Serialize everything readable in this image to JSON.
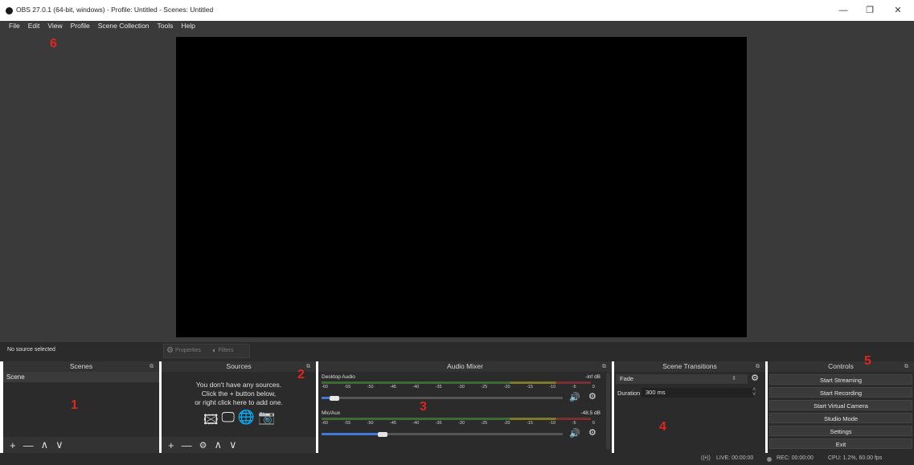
{
  "window": {
    "title": "OBS 27.0.1 (64-bit, windows) - Profile: Untitled - Scenes: Untitled",
    "minimize": "—",
    "maximize": "❐",
    "close": "✕"
  },
  "menu": [
    "File",
    "Edit",
    "View",
    "Profile",
    "Scene Collection",
    "Tools",
    "Help"
  ],
  "source_toolbar": {
    "status": "No source selected",
    "properties": "Properties",
    "filters": "Filters"
  },
  "scenes": {
    "title": "Scenes",
    "items": [
      "Scene"
    ]
  },
  "sources": {
    "title": "Sources",
    "empty_line1": "You don't have any sources.",
    "empty_line2": "Click the + button below,",
    "empty_line3": "or right click here to add one."
  },
  "mixer": {
    "title": "Audio Mixer",
    "channels": [
      {
        "name": "Desktop Audio",
        "db": "-inf dB",
        "volume": 0.04
      },
      {
        "name": "Mic/Aux",
        "db": "-48.5 dB",
        "volume": 0.24
      }
    ],
    "ticks": [
      "-60",
      "-55",
      "-50",
      "-45",
      "-40",
      "-35",
      "-30",
      "-25",
      "-20",
      "-15",
      "-10",
      "-5",
      "0"
    ]
  },
  "transitions": {
    "title": "Scene Transitions",
    "selected": "Fade",
    "duration_label": "Duration",
    "duration_value": "300 ms"
  },
  "controls": {
    "title": "Controls",
    "buttons": [
      "Start Streaming",
      "Start Recording",
      "Start Virtual Camera",
      "Studio Mode",
      "Settings",
      "Exit"
    ]
  },
  "status": {
    "live": "LIVE: 00:00:00",
    "rec": "REC: 00:00:00",
    "cpu": "CPU: 1.2%, 60.00 fps"
  },
  "annotations": [
    "1",
    "2",
    "3",
    "4",
    "5",
    "6"
  ],
  "icons": [
    "obs-logo-icon",
    "gear-icon",
    "filter-icon",
    "float-icon",
    "image-icon",
    "display-icon",
    "globe-icon",
    "camera-icon",
    "speaker-icon",
    "plus-icon",
    "minus-icon",
    "up-icon",
    "down-icon",
    "broadcast-icon"
  ],
  "colors": {
    "background": "#3a3a3a",
    "dock": "#2b2b2b",
    "preview": "#000000",
    "annotation": "#e0261f",
    "volume_fill": "#3f7bd6"
  }
}
